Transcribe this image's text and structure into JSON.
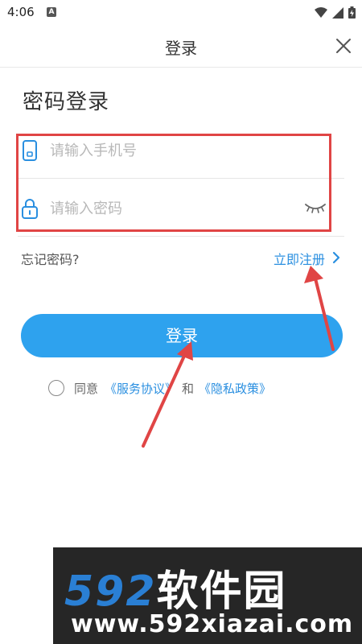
{
  "status_bar": {
    "time": "4:06",
    "notification_icon": "A"
  },
  "nav": {
    "title": "登录",
    "close_icon": "close-icon"
  },
  "heading": "密码登录",
  "form": {
    "phone_placeholder": "请输入手机号",
    "phone_value": "",
    "password_placeholder": "请输入密码",
    "password_value": ""
  },
  "links": {
    "forgot": "忘记密码?",
    "register": "立即注册"
  },
  "login_button": "登录",
  "agreement": {
    "prefix": "同意",
    "service": "《服务协议》",
    "and": "和",
    "privacy": "《隐私政策》",
    "checked": false
  },
  "watermark": {
    "number": "592",
    "name": "软件园",
    "url": "www.592xiazai.com"
  },
  "colors": {
    "accent": "#2ea2ee",
    "link": "#2a8fe0",
    "annotation": "#e04545"
  }
}
